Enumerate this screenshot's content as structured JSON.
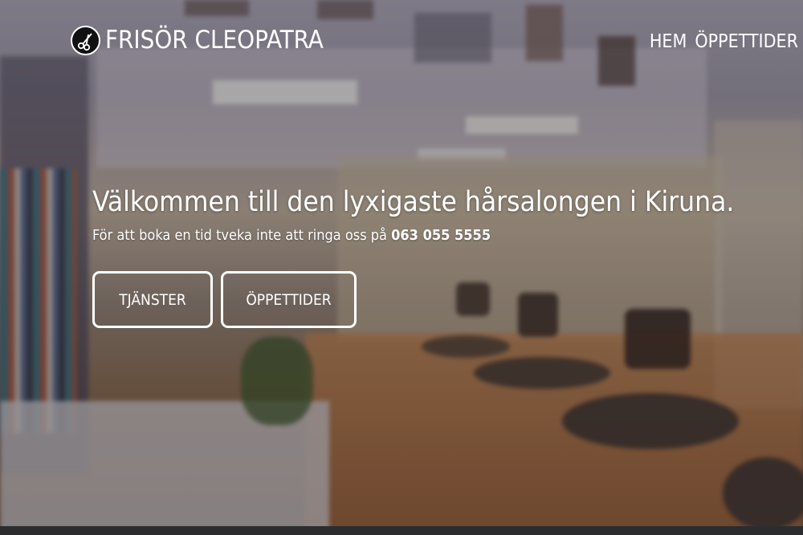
{
  "brand": {
    "name": "FRISÖR CLEOPATRA",
    "logo_icon": "scissors-icon"
  },
  "nav": {
    "items": [
      {
        "label": "HEM"
      },
      {
        "label": "ÖPPETTIDER"
      }
    ]
  },
  "hero": {
    "headline": "Välkommen till den lyxigaste hårsalongen i Kiruna.",
    "subline_prefix": "För att boka en tid tveka inte att ringa oss på",
    "phone": "063 055 5555"
  },
  "buttons": {
    "services_label": "TJÄNSTER",
    "hours_label": "ÖPPETTIDER"
  },
  "colors": {
    "text": "#ffffff",
    "overlay": "rgba(20,18,22,0.34)",
    "footer": "#2c2c2e"
  }
}
